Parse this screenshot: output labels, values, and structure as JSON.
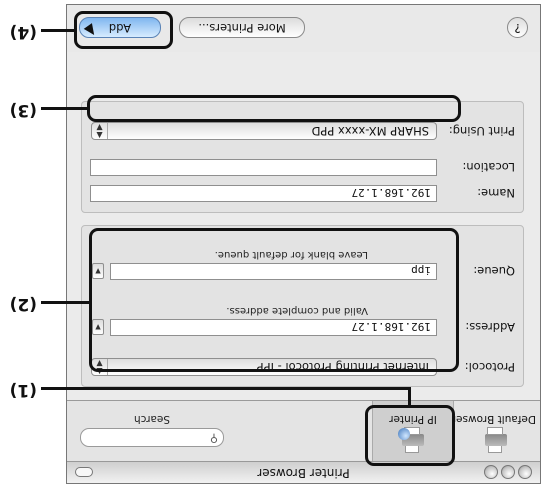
{
  "window": {
    "title": "Printer Browser"
  },
  "toolbar": {
    "default_browser": "Default Browser",
    "ip_printer": "IP Printer",
    "search_label": "Search",
    "search_placeholder": ""
  },
  "ip_group": {
    "protocol_label": "Protocol:",
    "protocol_value": "Internet Printing Protocol - IPP",
    "address_label": "Address:",
    "address_value": "192.168.1.27",
    "address_hint": "Valid and complete address.",
    "queue_label": "Queue:",
    "queue_value": "ipp",
    "queue_hint": "Leave blank for default queue."
  },
  "printer_group": {
    "name_label": "Name:",
    "name_value": "192.168.1.27",
    "location_label": "Location:",
    "location_value": "",
    "print_using_label": "Print Using:",
    "print_using_value": "SHARP MX-xxxx PPD"
  },
  "buttons": {
    "help": "?",
    "more_printers": "More Printers...",
    "add": "Add"
  },
  "callouts": {
    "c1": "(1)",
    "c2": "(2)",
    "c3": "(3)",
    "c4": "(4)"
  },
  "colors": {
    "default_button": "#7fb6ef",
    "annotation": "#111111"
  }
}
